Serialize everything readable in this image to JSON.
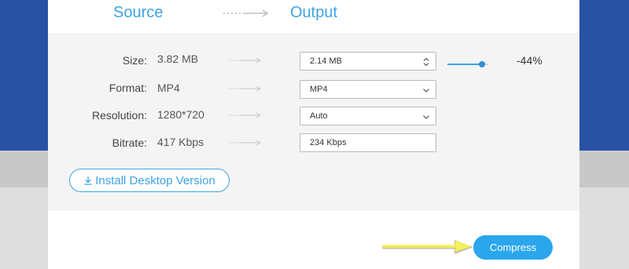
{
  "header": {
    "source_label": "Source",
    "output_label": "Output"
  },
  "rows": [
    {
      "label": "Size:",
      "source": "3.82 MB",
      "output": "2.14  MB",
      "control": "stepper"
    },
    {
      "label": "Format:",
      "source": "MP4",
      "output": "MP4",
      "control": "dropdown"
    },
    {
      "label": "Resolution:",
      "source": "1280*720",
      "output": "Auto",
      "control": "dropdown"
    },
    {
      "label": "Bitrate:",
      "source": "417  Kbps",
      "output": "234 Kbps",
      "control": "readonly"
    }
  ],
  "size_slider": {
    "level_fraction": 0.85,
    "percent_label": "-44%"
  },
  "install_button": {
    "label": "Install Desktop Version",
    "icon": "download-icon"
  },
  "compress_button": {
    "label": "Compress"
  },
  "colors": {
    "accent": "#3fa3e2",
    "compress": "#2aa6ec",
    "background_blue": "#2952a5",
    "pointer_arrow": "#f5ef5a"
  }
}
